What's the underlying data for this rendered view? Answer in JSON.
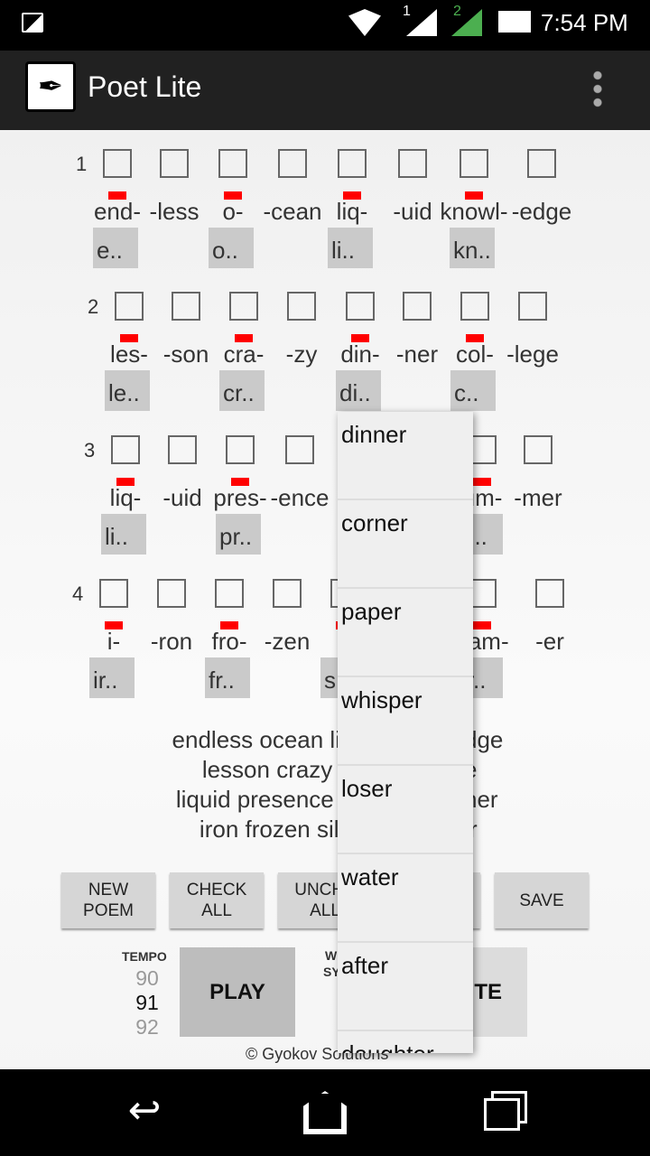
{
  "status_bar": {
    "time": "7:54 PM",
    "sim1": "1",
    "sim2": "2",
    "icons": [
      "image-icon",
      "wifi-icon",
      "signal-icon",
      "battery-icon"
    ]
  },
  "app_bar": {
    "title": "Poet Lite",
    "icon": "quill-icon",
    "menu_icon": "overflow-menu-icon"
  },
  "colors": {
    "stress": "#ff0000",
    "app_bar": "#212121",
    "hint_bg": "#cacaca"
  },
  "lines": [
    {
      "number": "1",
      "syllables": [
        {
          "text": "end-",
          "stressed": true,
          "hint": "e.."
        },
        {
          "text": "-less"
        },
        {
          "text": "o-",
          "stressed": true,
          "hint": "o.."
        },
        {
          "text": "-cean"
        },
        {
          "text": "liq-",
          "stressed": true,
          "hint": "li.."
        },
        {
          "text": "-uid"
        },
        {
          "text": "knowl-",
          "stressed": true,
          "hint": "kn.."
        },
        {
          "text": "-edge"
        }
      ]
    },
    {
      "number": "2",
      "syllables": [
        {
          "text": "les-",
          "stressed": true,
          "hint": "le.."
        },
        {
          "text": "-son"
        },
        {
          "text": "cra-",
          "stressed": true,
          "hint": "cr.."
        },
        {
          "text": "-zy"
        },
        {
          "text": "din-",
          "stressed": true,
          "hint": "di.."
        },
        {
          "text": "-ner"
        },
        {
          "text": "col-",
          "stressed": true,
          "hint": "c.."
        },
        {
          "text": "-lege"
        }
      ]
    },
    {
      "number": "3",
      "syllables": [
        {
          "text": "liq-",
          "stressed": true,
          "hint": "li.."
        },
        {
          "text": "-uid"
        },
        {
          "text": "pres-",
          "stressed": true,
          "hint": "pr.."
        },
        {
          "text": "-ence"
        },
        {
          "text": ""
        },
        {
          "text": ""
        },
        {
          "text": "um-",
          "stressed": true,
          "hint": "u.."
        },
        {
          "text": "-mer"
        }
      ]
    },
    {
      "number": "4",
      "syllables": [
        {
          "text": "i-",
          "stressed": true,
          "hint": "ir.."
        },
        {
          "text": "-ron"
        },
        {
          "text": "fro-",
          "stressed": true,
          "hint": "fr.."
        },
        {
          "text": "-zen"
        },
        {
          "text": "s",
          "stressed": true,
          "hint": "s"
        },
        {
          "text": ""
        },
        {
          "text": "eam-",
          "stressed": true,
          "hint": "lr.."
        },
        {
          "text": "-er"
        }
      ]
    }
  ],
  "poem": [
    {
      "left": "endless ocean lic",
      "right": "dge"
    },
    {
      "left": "lesson crazy d",
      "right": "e"
    },
    {
      "left": "liquid presence c",
      "right": "ner"
    },
    {
      "left": "iron frozen sile",
      "right": "r"
    }
  ],
  "buttons": {
    "new_poem": "NEW POEM",
    "check_all": "CHECK ALL",
    "uncheck_all": "UNCHE ALL",
    "save": "SAVE",
    "play": "PLAY",
    "write": "ITE"
  },
  "tempo": {
    "label": "TEMPO",
    "prev": "90",
    "value": "91",
    "next": "92"
  },
  "word_syllables_label": {
    "line1": "W",
    "line2": "SY"
  },
  "footer": "© Gyokov Solutions",
  "dropdown": [
    "dinner",
    "corner",
    "paper",
    "whisper",
    "loser",
    "water",
    "after",
    "daughter"
  ]
}
